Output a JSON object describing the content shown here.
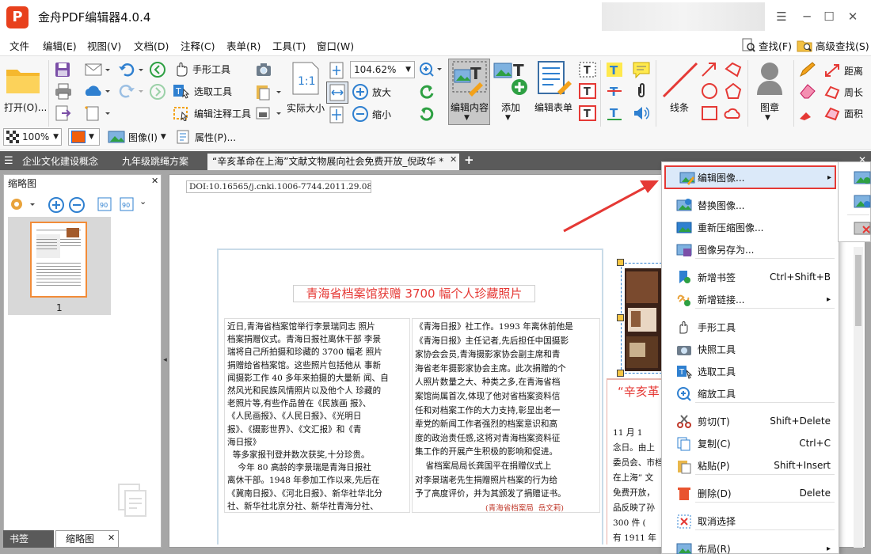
{
  "app": {
    "title": "金舟PDF编辑器4.0.4",
    "logo": "P"
  },
  "menu": [
    "文件",
    "编辑(E)",
    "视图(V)",
    "文档(D)",
    "注释(C)",
    "表单(R)",
    "工具(T)",
    "窗口(W)"
  ],
  "menu_right": {
    "find": "查找(F)",
    "advanced_find": "高级查找(S)"
  },
  "toolbar": {
    "open": "打开(O)...",
    "hand_tool": "手形工具",
    "select_tool": "选取工具",
    "edit_annot_tool": "编辑注释工具",
    "actual_size": "实际大小",
    "zoom_value": "104.62%",
    "zoom_in": "放大",
    "zoom_out": "缩小",
    "edit_content": "编辑内容",
    "add": "添加",
    "edit_form": "编辑表单",
    "lines": "线条",
    "stamp": "图章",
    "distance": "距离",
    "perimeter": "周长",
    "area": "面积",
    "opacity": "100%",
    "image": "图像(I)",
    "properties": "属性(P)..."
  },
  "tabs": [
    "企业文化建设概念",
    "九年级跳绳方案",
    "“辛亥革命在上海”文献文物展向社会免费开放_倪政华 *"
  ],
  "left_panel": {
    "title": "缩略图",
    "page_number": "1",
    "bottom_tabs": [
      "书签",
      "缩略图"
    ]
  },
  "document": {
    "doi": "DOI:10.16565/j.cnki.1006-7744.2011.29.089",
    "headline": "青海省档案馆获赠 3700 幅个人珍藏照片",
    "col1": [
      "近日,青海省档案馆举行李景瑞同志 照片",
      "档案捐赠仪式。青海日报社离休干部 李景",
      "瑞将自己所拍摄和珍藏的 3700 幅老 照片",
      "捐赠给省档案馆。这些照片包括他从 事新",
      "闻摄影工作 40 多年来拍摄的大量新 闻、自",
      "然风光和民族风情照片以及他个人 珍藏的",
      "老照片等,有些作品曾在《民族画 报》、",
      "《人民画报》、《人民日报》、《光明日",
      "报》、《摄影世界》、《文汇报》和《青",
      "海日报》",
      "  等多家报刊登并数次获奖,十分珍贵。",
      "    今年 80 高龄的李景瑞是青海日报社",
      "离休干部。1948 年参加工作以来,先后在",
      "《冀南日报》、《河北日报》、新华社华北分",
      "社、新华社北京分社、新华社青海分社、"
    ],
    "col2": [
      "《青海日报》社工作。1993 年离休前他是",
      "《青海日报》主任记者,先后担任中国摄影",
      "家协会会员,青海摄影家协会副主席和青",
      "海省老年摄影家协会主席。此次捐赠的个",
      "人照片数量之大、种类之多,在青海省档",
      "案馆尚属首次,体现了他对省档案资料信",
      "任和对档案工作的大力支持,彰显出老一",
      "辈党的新闻工作者强烈的档案意识和高",
      "度的政治责任感,这将对青海档案资料征",
      "集工作的开展产生积极的影响和促进。",
      "    省档案局局长龚国平在捐赠仪式上",
      "对李景瑞老先生捐赠照片档案的行为给",
      "予了高度评价，并为其颁发了捐赠证书。",
      "(青海省档案局  岳文莉)"
    ],
    "col3_headline": "“辛亥革",
    "col3": [
      "11 月 1",
      "念日。由上",
      "委员会、市档",
      "在上海” 文",
      "免费开放，",
      "品反映了孙",
      "300 件 (",
      "有 1911 年"
    ]
  },
  "context_menu": [
    {
      "icon": "edit-image-icon",
      "label": "编辑图像...",
      "shortcut": "",
      "submenu": true,
      "highlight": true
    },
    {
      "icon": "replace-image-icon",
      "label": "替换图像...",
      "shortcut": ""
    },
    {
      "icon": "recompress-image-icon",
      "label": "重新压缩图像...",
      "shortcut": ""
    },
    {
      "icon": "save-image-icon",
      "label": "图像另存为...",
      "shortcut": ""
    },
    {
      "icon": "bookmark-icon",
      "label": "新增书签",
      "shortcut": "Ctrl+Shift+B"
    },
    {
      "icon": "link-icon",
      "label": "新增链接...",
      "shortcut": "",
      "submenu": true
    },
    {
      "icon": "hand-icon",
      "label": "手形工具",
      "shortcut": ""
    },
    {
      "icon": "camera-icon",
      "label": "快照工具",
      "shortcut": ""
    },
    {
      "icon": "select-icon",
      "label": "选取工具",
      "shortcut": ""
    },
    {
      "icon": "zoom-icon",
      "label": "缩放工具",
      "shortcut": ""
    },
    {
      "icon": "cut-icon",
      "label": "剪切(T)",
      "shortcut": "Shift+Delete"
    },
    {
      "icon": "copy-icon",
      "label": "复制(C)",
      "shortcut": "Ctrl+C"
    },
    {
      "icon": "paste-icon",
      "label": "粘贴(P)",
      "shortcut": "Shift+Insert"
    },
    {
      "icon": "delete-icon",
      "label": "删除(D)",
      "shortcut": "Delete"
    },
    {
      "icon": "deselect-icon",
      "label": "取消选择",
      "shortcut": ""
    },
    {
      "icon": "layout-icon",
      "label": "布局(R)",
      "shortcut": "",
      "submenu": true
    }
  ],
  "colors": {
    "accent_red": "#e53935",
    "title_red": "#e8401c",
    "tab_dark": "#5a5a5a",
    "highlight": "#dbe9f9"
  }
}
